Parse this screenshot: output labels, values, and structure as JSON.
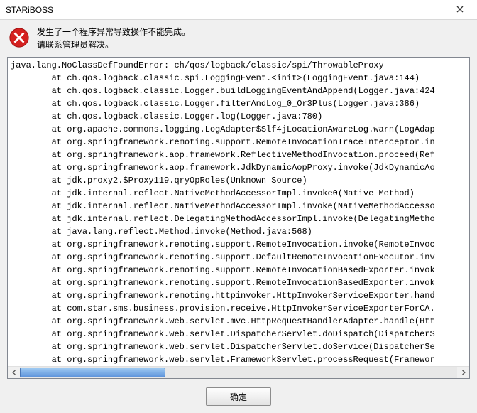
{
  "window": {
    "title": "STARiBOSS"
  },
  "message": {
    "line1": "发生了一个程序异常导致操作不能完成。",
    "line2": "请联系管理员解决。"
  },
  "stacktrace": "java.lang.NoClassDefFoundError: ch/qos/logback/classic/spi/ThrowableProxy\n        at ch.qos.logback.classic.spi.LoggingEvent.<init>(LoggingEvent.java:144)\n        at ch.qos.logback.classic.Logger.buildLoggingEventAndAppend(Logger.java:424\n        at ch.qos.logback.classic.Logger.filterAndLog_0_Or3Plus(Logger.java:386)\n        at ch.qos.logback.classic.Logger.log(Logger.java:780)\n        at org.apache.commons.logging.LogAdapter$Slf4jLocationAwareLog.warn(LogAdap\n        at org.springframework.remoting.support.RemoteInvocationTraceInterceptor.in\n        at org.springframework.aop.framework.ReflectiveMethodInvocation.proceed(Ref\n        at org.springframework.aop.framework.JdkDynamicAopProxy.invoke(JdkDynamicAo\n        at jdk.proxy2.$Proxy119.qryOpRoles(Unknown Source)\n        at jdk.internal.reflect.NativeMethodAccessorImpl.invoke0(Native Method)\n        at jdk.internal.reflect.NativeMethodAccessorImpl.invoke(NativeMethodAccesso\n        at jdk.internal.reflect.DelegatingMethodAccessorImpl.invoke(DelegatingMetho\n        at java.lang.reflect.Method.invoke(Method.java:568)\n        at org.springframework.remoting.support.RemoteInvocation.invoke(RemoteInvoc\n        at org.springframework.remoting.support.DefaultRemoteInvocationExecutor.inv\n        at org.springframework.remoting.support.RemoteInvocationBasedExporter.invok\n        at org.springframework.remoting.support.RemoteInvocationBasedExporter.invok\n        at org.springframework.remoting.httpinvoker.HttpInvokerServiceExporter.hand\n        at com.star.sms.business.provision.receive.HttpInvokerServiceExporterForCA.\n        at org.springframework.web.servlet.mvc.HttpRequestHandlerAdapter.handle(Htt\n        at org.springframework.web.servlet.DispatcherServlet.doDispatch(DispatcherS\n        at org.springframework.web.servlet.DispatcherServlet.doService(DispatcherSe\n        at org.springframework.web.servlet.FrameworkServlet.processRequest(Framewor",
  "buttons": {
    "ok_label": "确定"
  },
  "icons": {
    "error": "error-circle",
    "close": "close-x"
  },
  "colors": {
    "error_red": "#d4201f",
    "scrollbar_thumb": "#5f95dc"
  }
}
